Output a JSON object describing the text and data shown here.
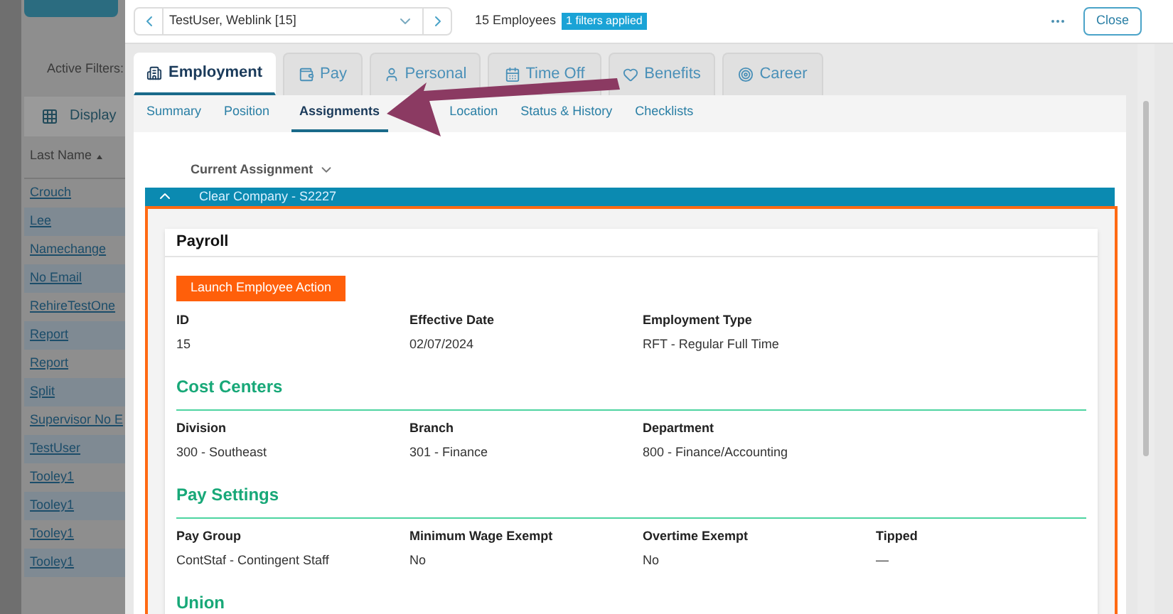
{
  "sidebar": {
    "filters_label": "Active Filters:",
    "display_button": "Display",
    "column_header": "Last Name",
    "rows": [
      "Crouch",
      "Lee",
      "Namechange",
      "No Email",
      "RehireTestOne",
      "Report",
      "Report",
      "Split",
      "Supervisor No E",
      "TestUser",
      "Tooley1",
      "Tooley1",
      "Tooley1",
      "Tooley1"
    ]
  },
  "header": {
    "record": "TestUser, Weblink [15]",
    "count": "15 Employees",
    "badge": "1 filters applied",
    "close": "Close"
  },
  "tabs": [
    {
      "label": "Employment",
      "selected": true
    },
    {
      "label": "Pay",
      "selected": false
    },
    {
      "label": "Personal",
      "selected": false
    },
    {
      "label": "Time Off",
      "selected": false
    },
    {
      "label": "Benefits",
      "selected": false
    },
    {
      "label": "Career",
      "selected": false
    }
  ],
  "subtabs": [
    {
      "label": "Summary",
      "selected": false
    },
    {
      "label": "Position",
      "selected": false
    },
    {
      "label": "Assignments",
      "selected": true
    },
    {
      "label": "Location",
      "selected": false
    },
    {
      "label": "Status & History",
      "selected": false
    },
    {
      "label": "Checklists",
      "selected": false
    }
  ],
  "assignment_filter": "Current Assignment",
  "assignment": {
    "title": "Clear Company - S2227",
    "expanded": true
  },
  "card": {
    "title": "Payroll",
    "action": "Launch Employee Action",
    "fields": [
      {
        "label": "ID",
        "value": "15"
      },
      {
        "label": "Effective Date",
        "value": "02/07/2024"
      },
      {
        "label": "Employment Type",
        "value": "RFT - Regular Full Time"
      }
    ],
    "sections": [
      {
        "title": "Cost Centers",
        "fields": [
          {
            "label": "Division",
            "value": "300 - Southeast"
          },
          {
            "label": "Branch",
            "value": "301 - Finance"
          },
          {
            "label": "Department",
            "value": "800 - Finance/Accounting"
          }
        ]
      },
      {
        "title": "Pay Settings",
        "fields": [
          {
            "label": "Pay Group",
            "value": "ContStaf - Contingent Staff"
          },
          {
            "label": "Minimum Wage Exempt",
            "value": "No"
          },
          {
            "label": "Overtime Exempt",
            "value": "No"
          },
          {
            "label": "Tipped",
            "value": "—"
          }
        ]
      },
      {
        "title": "Union"
      }
    ]
  }
}
